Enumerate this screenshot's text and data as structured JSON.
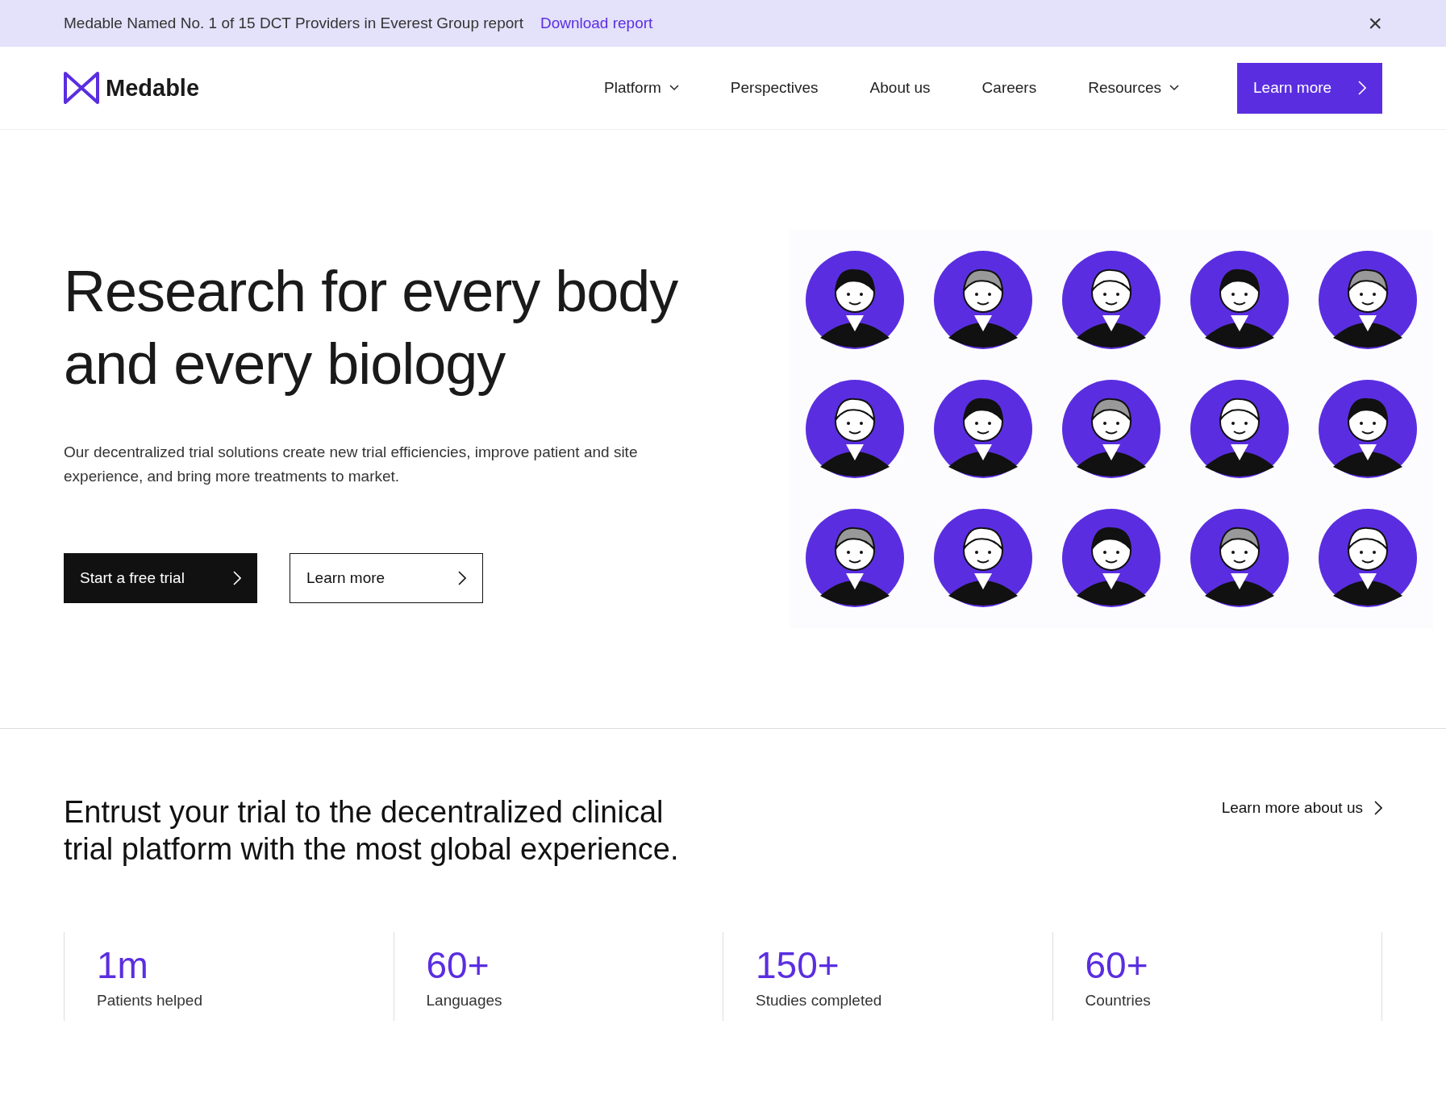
{
  "banner": {
    "text": "Medable Named No. 1 of 15 DCT Providers in Everest Group report",
    "link": "Download report",
    "close": "×"
  },
  "nav": {
    "logo": "Medable",
    "items": [
      {
        "label": "Platform",
        "dropdown": true
      },
      {
        "label": "Perspectives",
        "dropdown": false
      },
      {
        "label": "About us",
        "dropdown": false
      },
      {
        "label": "Careers",
        "dropdown": false
      },
      {
        "label": "Resources",
        "dropdown": true
      }
    ],
    "cta": "Learn more"
  },
  "hero": {
    "title": "Research for every body and every biology",
    "text": "Our decentralized trial solutions create new trial efficiencies, improve patient and site experience, and bring more treatments to market.",
    "buttons": [
      {
        "label": "Start a free trial",
        "kind": "primary"
      },
      {
        "label": "Learn more",
        "kind": "outline"
      }
    ]
  },
  "section": {
    "heading": "Entrust your trial to the decentralized clinical trial platform with the most global experience.",
    "link": "Learn more about us"
  },
  "stats": [
    {
      "value": "1m",
      "label": "Patients helped"
    },
    {
      "value": "60+",
      "label": "Languages"
    },
    {
      "value": "150+",
      "label": "Studies completed"
    },
    {
      "value": "60+",
      "label": "Countries"
    }
  ]
}
